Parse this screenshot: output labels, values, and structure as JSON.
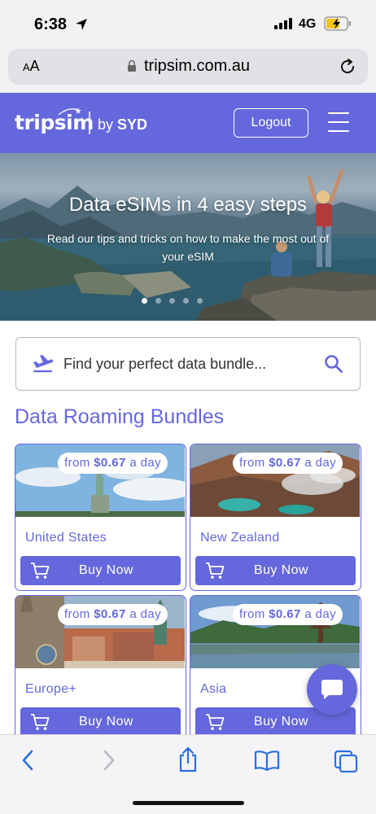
{
  "status_bar": {
    "time": "6:38",
    "network": "4G"
  },
  "browser": {
    "text_size_label_small": "A",
    "text_size_label_large": "A",
    "url": "tripsim.com.au"
  },
  "header": {
    "logo_text": "tripsim",
    "logo_by": "by",
    "logo_brand": "SYD",
    "logout_label": "Logout"
  },
  "hero": {
    "title": "Data eSIMs in 4 easy steps",
    "subtitle": "Read our tips and tricks on how to make the most out of your eSIM",
    "slide_count": 5,
    "active_slide": 1
  },
  "search": {
    "placeholder": "Find your perfect data bundle..."
  },
  "section_title": "Data Roaming Bundles",
  "bundles": [
    {
      "name": "United States",
      "price_prefix": "from",
      "price": "$0.67",
      "price_suffix": "a day",
      "buy_label": "Buy Now"
    },
    {
      "name": "New Zealand",
      "price_prefix": "from",
      "price": "$0.67",
      "price_suffix": "a day",
      "buy_label": "Buy Now"
    },
    {
      "name": "Europe+",
      "price_prefix": "from",
      "price": "$0.67",
      "price_suffix": "a day",
      "buy_label": "Buy Now"
    },
    {
      "name": "Asia",
      "price_prefix": "from",
      "price": "$0.67",
      "price_suffix": "a day",
      "buy_label": "Buy Now"
    }
  ],
  "colors": {
    "brand": "#6567dd",
    "white": "#ffffff",
    "safari_chrome": "#f2f2f4"
  },
  "icons": {
    "status": [
      "location-arrow-icon",
      "signal-bars-icon",
      "battery-charging-icon"
    ],
    "browser": [
      "lock-icon",
      "reload-icon"
    ],
    "toolbar": [
      "back-icon",
      "forward-icon",
      "share-icon",
      "bookmarks-icon",
      "tabs-icon"
    ],
    "page": [
      "hamburger-menu-icon",
      "plane-icon",
      "search-icon",
      "cart-icon",
      "chat-icon"
    ]
  }
}
